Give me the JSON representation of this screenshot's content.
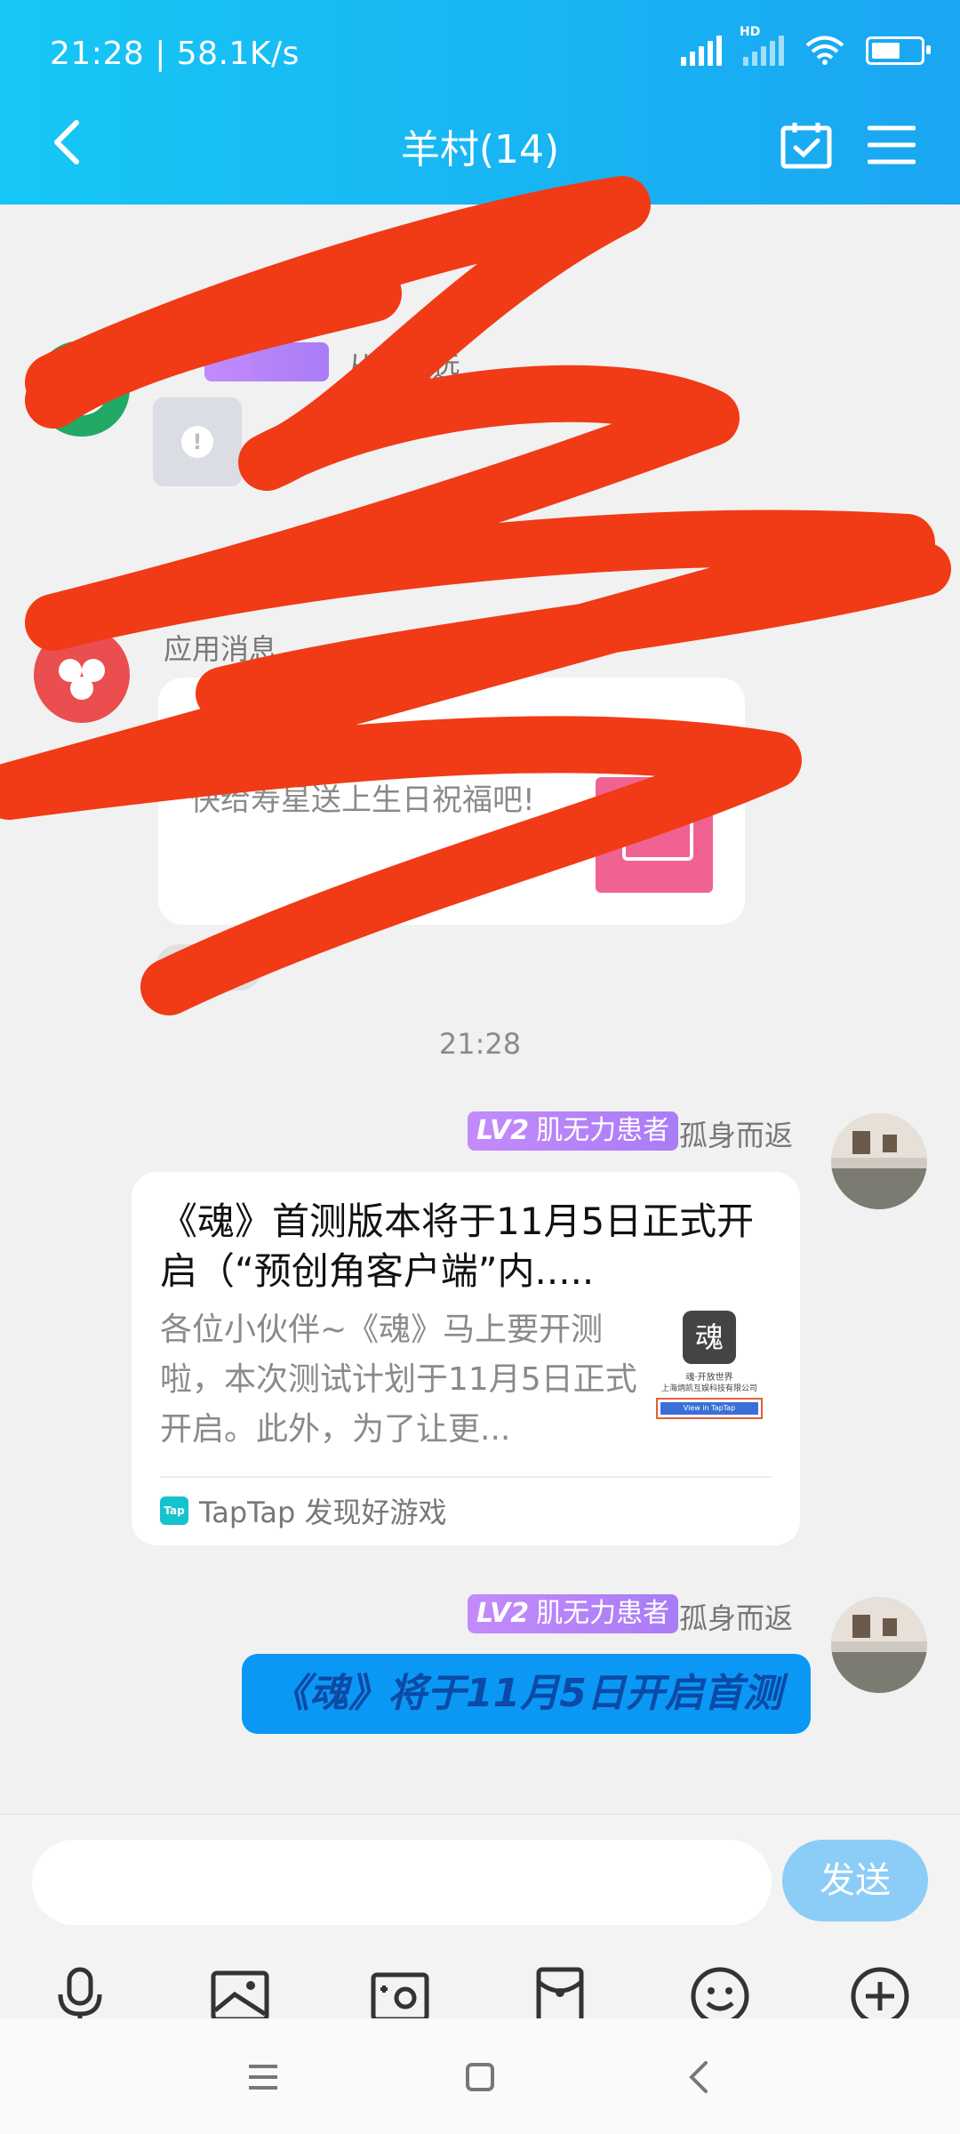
{
  "status_bar": {
    "time": "21:28 | 58.1K/s",
    "network_label": "HD",
    "battery_level": 0.6
  },
  "header": {
    "title": "羊村(14)"
  },
  "obscured": {
    "sender_name": "从未走远",
    "app_message_label": "应用消息",
    "app_message_text": "快给寿星送上生日祝福吧!",
    "chip_label": "群"
  },
  "timestamp": "21:28",
  "messages": [
    {
      "badge_level": "LV2",
      "badge_title": "肌无力患者",
      "sender": "孤身而返",
      "card": {
        "title": "《魂》首测版本将于11月5日正式开启（“预创角客户端”内.....",
        "description": "各位小伙伴~《魂》马上要开测啦，本次测试计划于11月5日正式开启。此外，为了让更...",
        "source": "TapTap 发现好游戏",
        "thumb_text_1": "魂",
        "thumb_text_2": "魂·开放世界",
        "thumb_text_3": "上海炳凯互娱科技有限公司",
        "thumb_button": "View in TapTap"
      }
    },
    {
      "badge_level": "LV2",
      "badge_title": "肌无力患者",
      "sender": "孤身而返",
      "text": "《魂》将于11月5日开启首测"
    }
  ],
  "input": {
    "placeholder": "",
    "send_label": "发送"
  },
  "toolbar_icons": [
    "microphone-icon",
    "image-icon",
    "camera-icon",
    "red-packet-icon",
    "emoji-icon",
    "plus-icon"
  ],
  "colors": {
    "header": "#1aa6f2",
    "bubble": "#0b98f5",
    "badge": "#b884f8",
    "scribble": "#f13a16"
  }
}
